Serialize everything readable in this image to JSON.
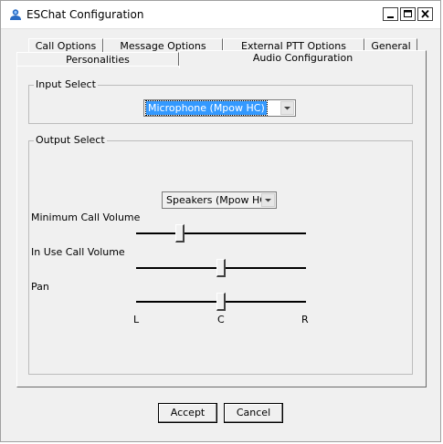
{
  "window": {
    "title": "ESChat Configuration"
  },
  "tabs": {
    "row1": [
      "Call Options",
      "Message Options",
      "External PTT Options",
      "General"
    ],
    "row2": [
      "Personalities",
      "Audio Configuration"
    ],
    "active": "Audio Configuration"
  },
  "input_select": {
    "label": "Input Select",
    "value": "Microphone (Mpow HC)"
  },
  "output_select": {
    "label": "Output Select",
    "value": "Speakers (Mpow HC)"
  },
  "sliders": {
    "min_call_volume": {
      "label": "Minimum Call Volume",
      "level_percent": 26
    },
    "in_use_call_volume": {
      "label": "In Use Call Volume",
      "level_percent": 50
    },
    "pan": {
      "label": "Pan",
      "level_percent": 50,
      "left_mark": "L",
      "center_mark": "C",
      "right_mark": "R"
    }
  },
  "buttons": {
    "accept": "Accept",
    "cancel": "Cancel"
  },
  "colors": {
    "selection": "#3399ff",
    "dialog_bg": "#f0f0f0"
  },
  "icons": {
    "app": "user-icon",
    "minimize": "minimize-icon",
    "maximize": "maximize-icon",
    "close": "close-icon",
    "dropdown": "chevron-down-icon"
  }
}
